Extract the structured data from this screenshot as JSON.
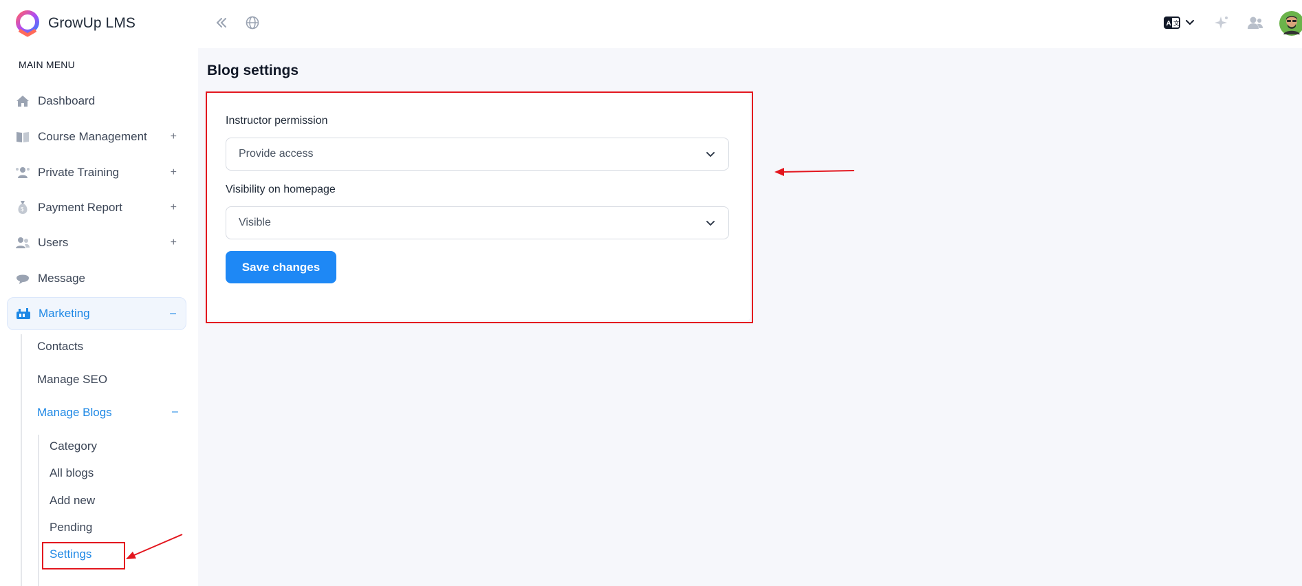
{
  "app": {
    "name": "GrowUp LMS"
  },
  "colors": {
    "accent": "#1e88f5",
    "annotation": "#e3161e",
    "sidebar_bg": "#ffffff",
    "page_bg": "#f6f7fb"
  },
  "header": {
    "icons": [
      "collapse-sidebar-icon",
      "globe-icon",
      "language-icon",
      "chevron-down-icon",
      "sparkle-icon",
      "users-icon",
      "avatar"
    ]
  },
  "sidebar": {
    "heading": "MAIN MENU",
    "items": [
      {
        "label": "Dashboard",
        "icon": "home-icon",
        "sign": ""
      },
      {
        "label": "Course Management",
        "icon": "book-icon",
        "sign": "+"
      },
      {
        "label": "Private Training",
        "icon": "training-icon",
        "sign": "+"
      },
      {
        "label": "Payment Report",
        "icon": "money-bag-icon",
        "sign": "+"
      },
      {
        "label": "Users",
        "icon": "users-icon",
        "sign": "+"
      },
      {
        "label": "Message",
        "icon": "message-icon",
        "sign": ""
      },
      {
        "label": "Marketing",
        "icon": "marketing-icon",
        "sign": "–"
      }
    ],
    "marketing_sub": [
      {
        "label": "Contacts"
      },
      {
        "label": "Manage SEO"
      },
      {
        "label": "Manage Blogs",
        "sign": "–"
      }
    ],
    "blogs_sub": [
      {
        "label": "Category"
      },
      {
        "label": "All blogs"
      },
      {
        "label": "Add new"
      },
      {
        "label": "Pending"
      },
      {
        "label": "Settings"
      }
    ]
  },
  "main": {
    "title": "Blog settings",
    "form": {
      "instructor_permission": {
        "label": "Instructor permission",
        "value": "Provide access"
      },
      "visibility": {
        "label": "Visibility on homepage",
        "value": "Visible"
      },
      "save_label": "Save changes"
    }
  }
}
